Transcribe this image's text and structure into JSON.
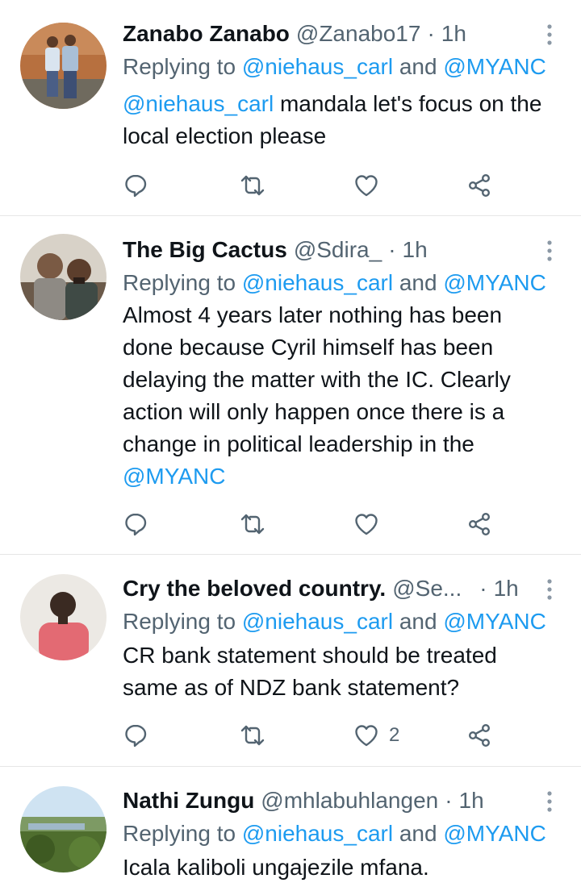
{
  "tweets": [
    {
      "name": "Zanabo Zanabo",
      "handle": "@Zanabo17",
      "time": "1h",
      "reply_prefix": "Replying to",
      "reply_to_1": "@niehaus_carl",
      "reply_and": "and",
      "reply_to_2": "@MYANC",
      "text_mention": "@niehaus_carl",
      "text": " mandala let's focus on the local election please",
      "like_count": ""
    },
    {
      "name": "The Big Cactus",
      "handle": "@Sdira_",
      "time": "1h",
      "reply_prefix": "Replying to",
      "reply_to_1": "@niehaus_carl",
      "reply_and": "and",
      "reply_to_2": "@MYANC",
      "text": "Almost 4 years later nothing has been done because Cyril himself has been delaying the matter with the IC. Clearly action will only happen once there is a change in political leadership in the ",
      "text_mention_end": "@MYANC",
      "like_count": ""
    },
    {
      "name": "Cry the beloved country.",
      "handle": "@Se...",
      "time": "1h",
      "reply_prefix": "Replying to",
      "reply_to_1": "@niehaus_carl",
      "reply_and": "and",
      "reply_to_2": "@MYANC",
      "text": "CR bank statement should be treated same as of NDZ bank statement?",
      "like_count": "2"
    },
    {
      "name": "Nathi Zungu",
      "handle": "@mhlabuhlangen",
      "time": "1h",
      "reply_prefix": "Replying to",
      "reply_to_1": "@niehaus_carl",
      "reply_and": "and",
      "reply_to_2": "@MYANC",
      "text": "Icala kaliboli ungajezile mfana.",
      "like_count": ""
    }
  ],
  "separator": "·",
  "colors": {
    "link": "#1d9bf0",
    "secondary_text": "#536471",
    "primary_text": "#0f1419",
    "divider": "#e6e6e6"
  },
  "icons": [
    "reply-icon",
    "retweet-icon",
    "like-icon",
    "share-icon",
    "more-icon"
  ]
}
